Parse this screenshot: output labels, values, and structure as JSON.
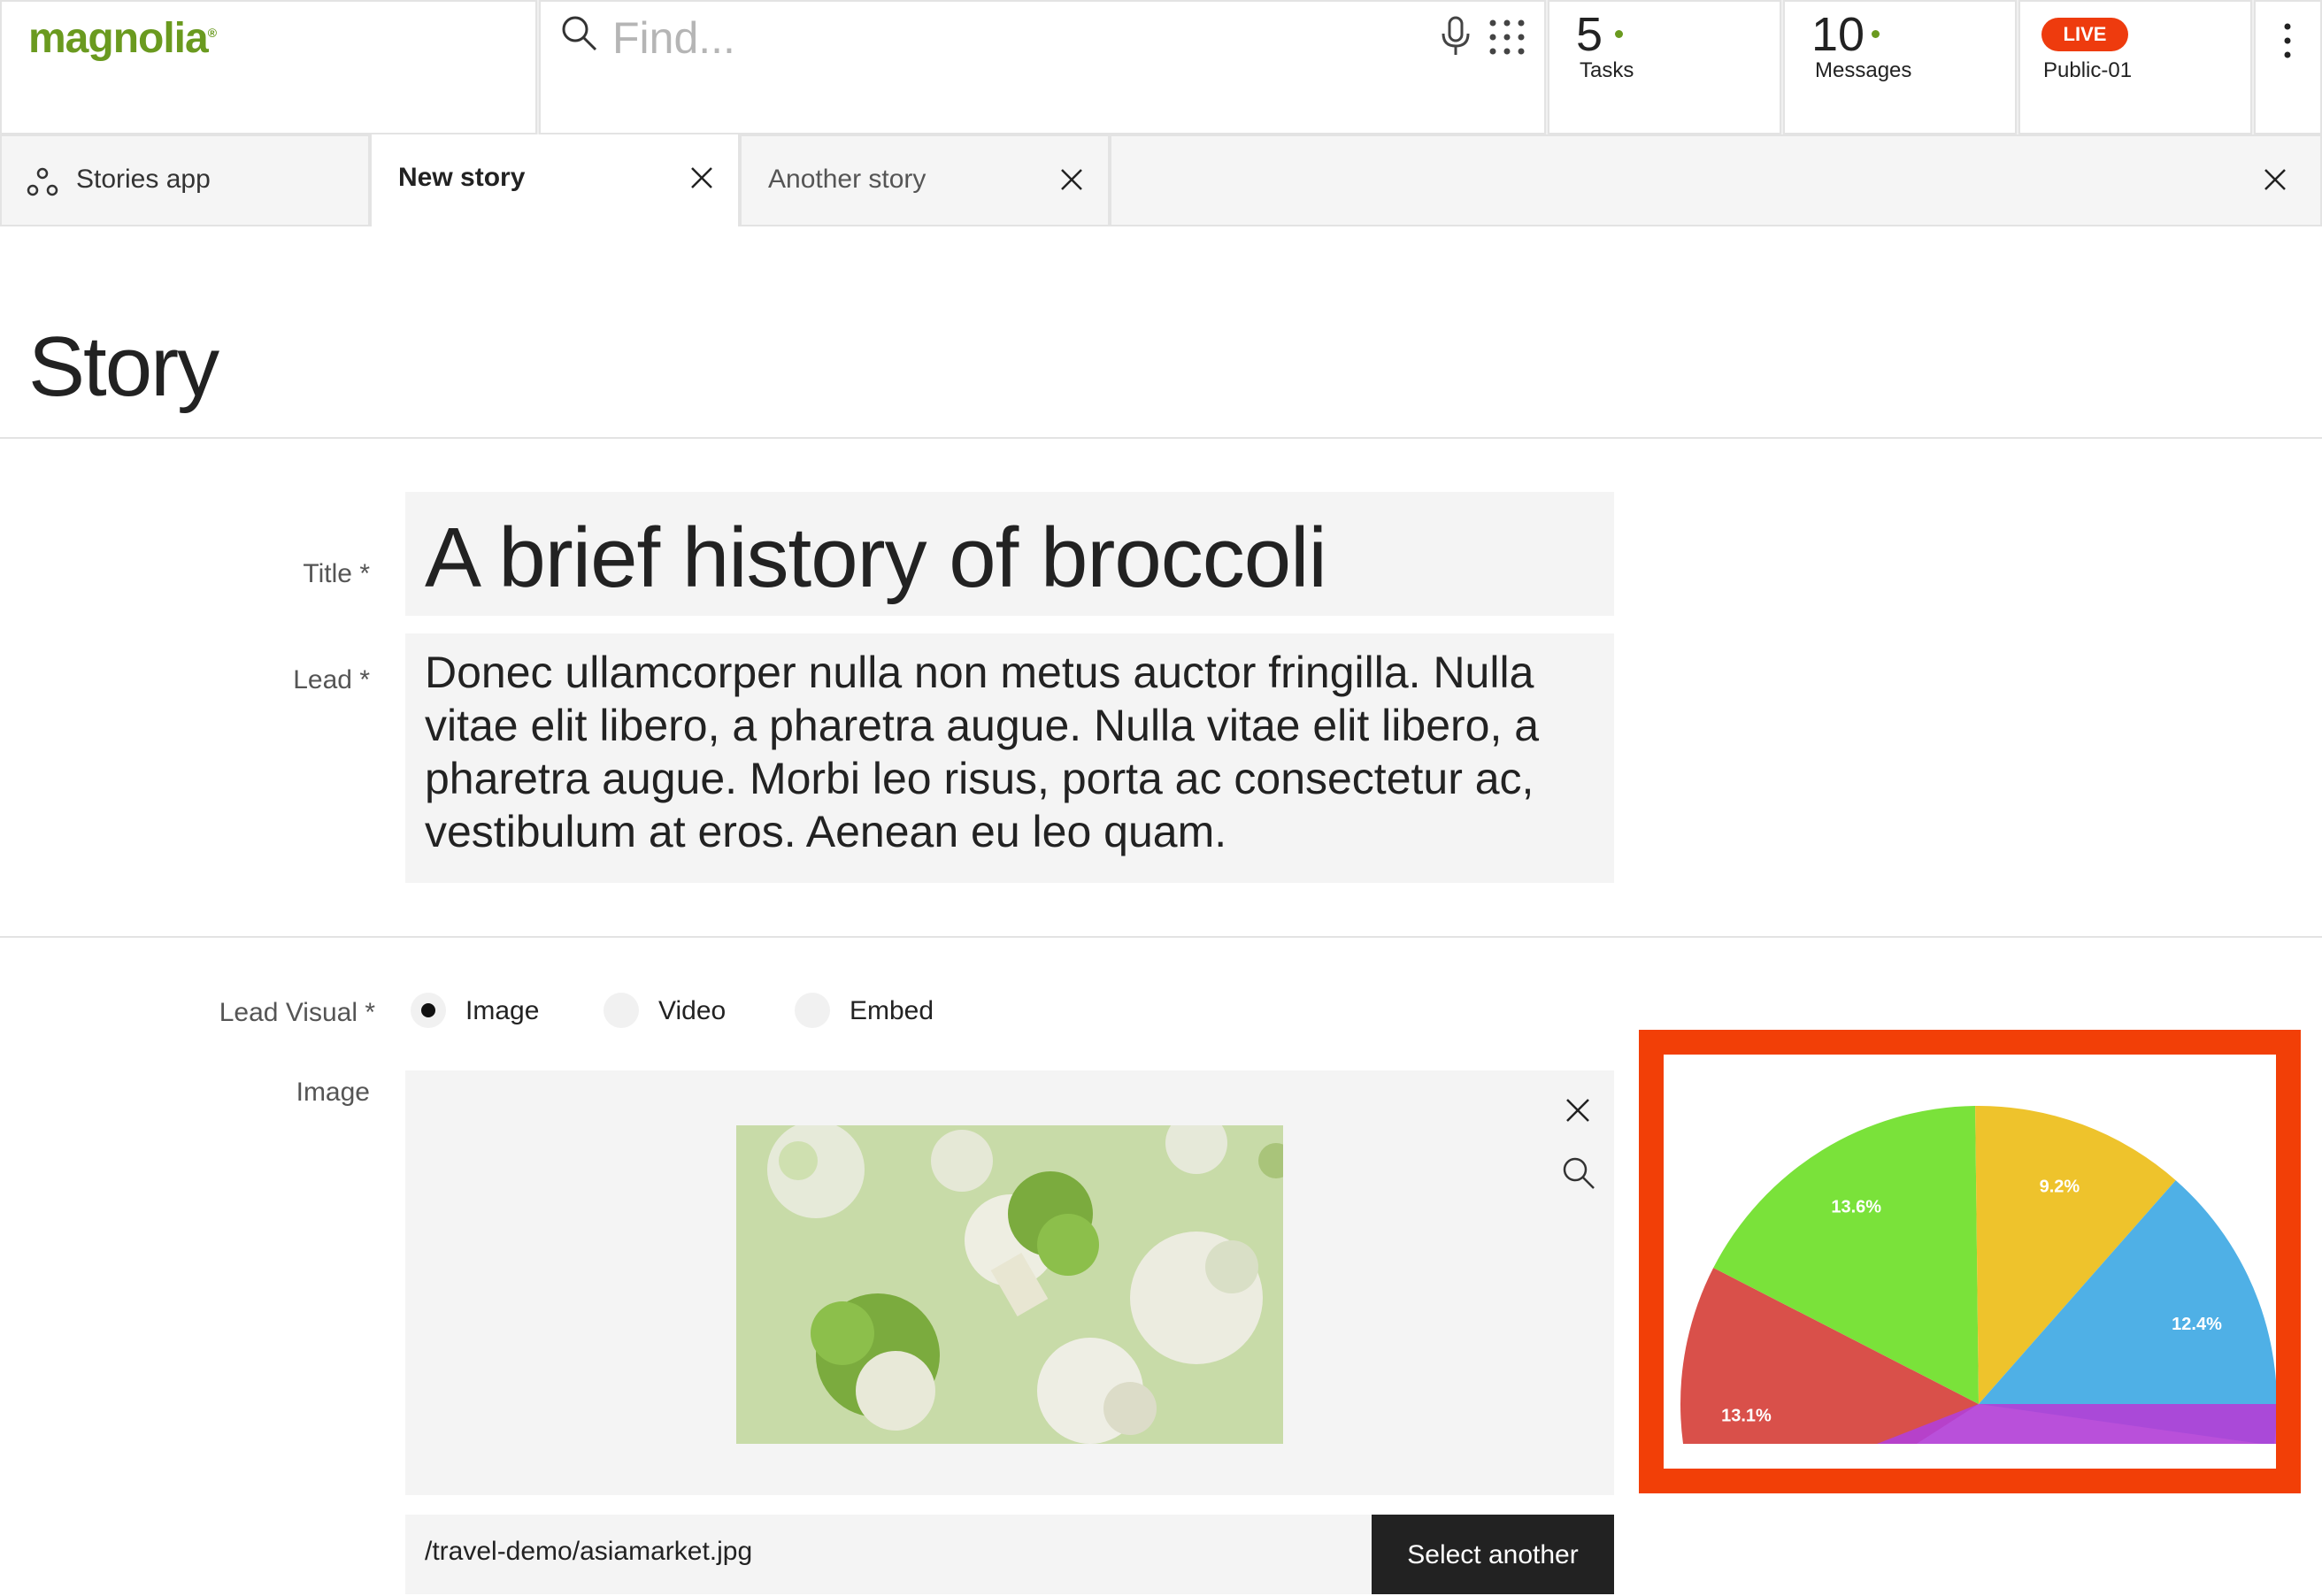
{
  "app": {
    "logo": "magnolia",
    "logo_mark": "®"
  },
  "search": {
    "placeholder": "Find..."
  },
  "counters": {
    "tasks": {
      "count": "5",
      "label": "Tasks"
    },
    "messages": {
      "count": "10",
      "label": "Messages"
    }
  },
  "environment": {
    "badge": "LIVE",
    "name": "Public-01"
  },
  "tabs": [
    {
      "label": "Stories app",
      "active": false
    },
    {
      "label": "New story",
      "active": true
    },
    {
      "label": "Another story",
      "active": false
    }
  ],
  "page": {
    "title": "Story"
  },
  "form": {
    "title": {
      "label": "Title *",
      "value": "A brief history of broccoli"
    },
    "lead": {
      "label": "Lead *",
      "value": "Donec ullamcorper nulla non metus auctor fringilla. Nulla vitae elit libero, a pharetra augue. Nulla vitae elit libero, a pharetra augue. Morbi leo risus, porta ac consectetur ac, vestibulum at eros. Aenean eu leo quam."
    },
    "lead_visual": {
      "label": "Lead Visual *",
      "options": [
        {
          "label": "Image",
          "selected": true
        },
        {
          "label": "Video",
          "selected": false
        },
        {
          "label": "Embed",
          "selected": false
        }
      ]
    },
    "image": {
      "label": "Image",
      "path": "/travel-demo/asiamarket.jpg",
      "select_label": "Select another"
    }
  },
  "colors": {
    "accent": "#6a9a1f",
    "live": "#ee3b0e",
    "highlight_frame": "#f23f07"
  },
  "chart_data": {
    "type": "pie",
    "title": "",
    "layout": "half-donut",
    "slices": [
      {
        "label": "13.1%",
        "value": 13.1,
        "color": "#d9504a"
      },
      {
        "label": "13.6%",
        "value": 13.6,
        "color": "#7ae23a"
      },
      {
        "label": "9.2%",
        "value": 9.2,
        "color": "#eec32c"
      },
      {
        "label": "12.4%",
        "value": 12.4,
        "color": "#4fb0e6"
      },
      {
        "label": "",
        "value": 1.7,
        "color": "#b23fd6"
      }
    ]
  }
}
